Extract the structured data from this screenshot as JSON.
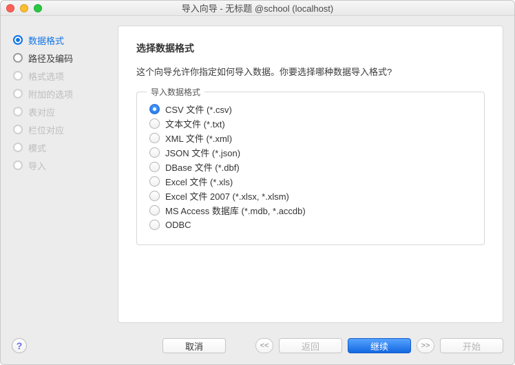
{
  "window_title": "导入向导 - 无标题 @school (localhost)",
  "sidebar_steps": [
    {
      "label": "数据格式",
      "state": "active"
    },
    {
      "label": "路径及编码",
      "state": "enabled"
    },
    {
      "label": "格式选项",
      "state": "disabled"
    },
    {
      "label": "附加的选项",
      "state": "disabled"
    },
    {
      "label": "表对应",
      "state": "disabled"
    },
    {
      "label": "栏位对应",
      "state": "disabled"
    },
    {
      "label": "模式",
      "state": "disabled"
    },
    {
      "label": "导入",
      "state": "disabled"
    }
  ],
  "main": {
    "heading": "选择数据格式",
    "description": "这个向导允许你指定如何导入数据。你要选择哪种数据导入格式?",
    "fieldset_legend": "导入数据格式",
    "options": [
      {
        "label": "CSV 文件 (*.csv)",
        "checked": true
      },
      {
        "label": "文本文件 (*.txt)",
        "checked": false
      },
      {
        "label": "XML 文件 (*.xml)",
        "checked": false
      },
      {
        "label": "JSON 文件 (*.json)",
        "checked": false
      },
      {
        "label": "DBase 文件 (*.dbf)",
        "checked": false
      },
      {
        "label": "Excel 文件 (*.xls)",
        "checked": false
      },
      {
        "label": "Excel 文件 2007 (*.xlsx, *.xlsm)",
        "checked": false
      },
      {
        "label": "MS Access 数据库 (*.mdb, *.accdb)",
        "checked": false
      },
      {
        "label": "ODBC",
        "checked": false
      }
    ]
  },
  "footer": {
    "help": "?",
    "cancel": "取消",
    "first": "<<",
    "back": "返回",
    "next": "继续",
    "last": ">>",
    "start": "开始"
  }
}
